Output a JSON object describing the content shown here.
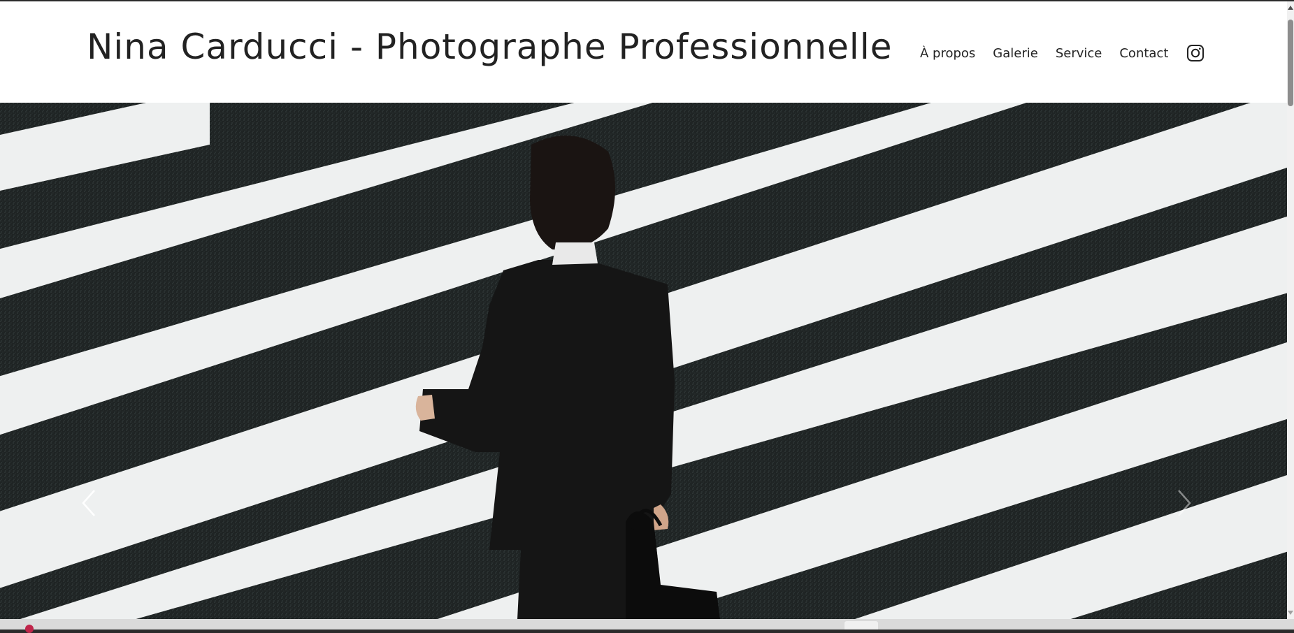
{
  "header": {
    "title": "Nina Carducci - Photographe Professionnelle"
  },
  "nav": {
    "items": [
      {
        "label": "À propos"
      },
      {
        "label": "Galerie"
      },
      {
        "label": "Service"
      },
      {
        "label": "Contact"
      }
    ],
    "social_icon": "instagram-icon"
  },
  "hero": {
    "image_alt": "Man in suit walking across crosswalk",
    "prev_icon": "chevron-left-icon",
    "next_icon": "chevron-right-icon"
  },
  "colors": {
    "text": "#222222",
    "background": "#ffffff",
    "asphalt": "#1f2424",
    "stripe": "#eef0f0"
  }
}
